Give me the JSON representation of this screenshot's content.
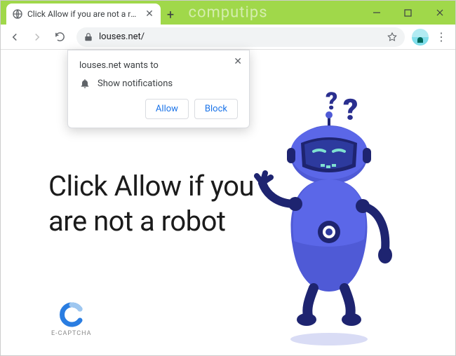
{
  "window": {
    "watermark": "computips",
    "tab_title": "Click Allow if you are not a robot"
  },
  "toolbar": {
    "url": "louses.net/"
  },
  "permission": {
    "title": "louses.net wants to",
    "item": "Show notifications",
    "allow": "Allow",
    "block": "Block"
  },
  "page": {
    "headline": "Click Allow if you are not a robot",
    "logo_text": "E-CAPTCHA"
  }
}
